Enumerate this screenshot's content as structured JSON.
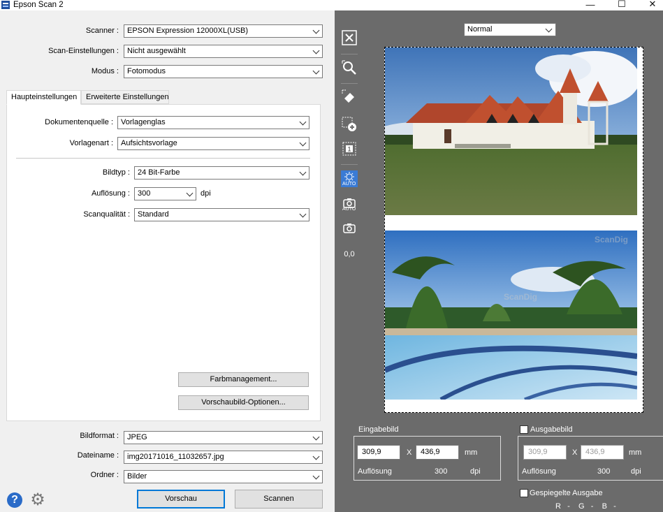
{
  "window": {
    "title": "Epson Scan 2",
    "minimize": "—",
    "maximize": "☐",
    "close": "✕"
  },
  "settings": {
    "scanner_label": "Scanner :",
    "scanner_value": "EPSON Expression 12000XL(USB)",
    "scan_settings_label": "Scan-Einstellungen :",
    "scan_settings_value": "Nicht ausgewählt",
    "mode_label": "Modus :",
    "mode_value": "Fotomodus"
  },
  "tabs": [
    {
      "label": "Haupteinstellungen",
      "active": true
    },
    {
      "label": "Erweiterte Einstellungen",
      "active": false
    }
  ],
  "main": {
    "source_label": "Dokumentenquelle :",
    "source_value": "Vorlagenglas",
    "doc_type_label": "Vorlagenart :",
    "doc_type_value": "Aufsichtsvorlage",
    "image_type_label": "Bildtyp :",
    "image_type_value": "24 Bit-Farbe",
    "resolution_label": "Auflösung :",
    "resolution_value": "300",
    "resolution_unit": "dpi",
    "quality_label": "Scanqualität :",
    "quality_value": "Standard",
    "color_mgmt_button": "Farbmanagement...",
    "preview_options_button": "Vorschaubild-Optionen..."
  },
  "output": {
    "format_label": "Bildformat :",
    "format_value": "JPEG",
    "filename_label": "Dateiname :",
    "filename_value": "img20171016_11032657.jpg",
    "folder_label": "Ordner :",
    "folder_value": "Bilder"
  },
  "actions": {
    "preview_button": "Vorschau",
    "scan_button": "Scannen"
  },
  "preview": {
    "view_mode": "Normal",
    "zoom_value": "0,0",
    "auto_label": "AUTO",
    "watermark": "ScanDig"
  },
  "input_image": {
    "label": "Eingabebild",
    "width": "309,9",
    "x_sep": "X",
    "height": "436,9",
    "unit": "mm",
    "resolution_label": "Auflösung",
    "resolution": "300",
    "resolution_unit": "dpi"
  },
  "output_image": {
    "label": "Ausgabebild",
    "width": "309,9",
    "x_sep": "X",
    "height": "436,9",
    "unit": "mm",
    "resolution_label": "Auflösung",
    "resolution": "300",
    "resolution_unit": "dpi",
    "mirror_label": "Gespiegelte Ausgabe",
    "rgb_readout": "R   -    G   -    B   -"
  },
  "colors": {
    "accent": "#0078d7",
    "preview_bg": "#6b6b6b",
    "help_icon": "#2a6bc8"
  }
}
